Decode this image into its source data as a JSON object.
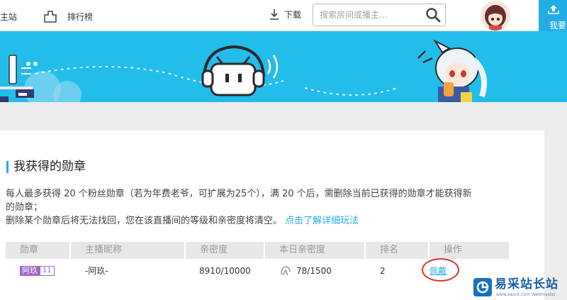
{
  "nav": {
    "main_label": "主站",
    "rank_label": "排行榜",
    "download_label": "下载",
    "search_placeholder": "搜索房间或播主...",
    "broadcast_label": "我要"
  },
  "panel": {
    "title": "我获得的勋章",
    "desc_line1": "每人最多获得 20 个粉丝勋章（若为年费老爷，可扩展为25个），满 20 个后，需删除当前已获得的勋章才能获得新",
    "desc_line2": "的勋章；",
    "desc_line3": "删除某个勋章后将无法找回，您在该直播间的等级和亲密度将清空。",
    "desc_link": "点击了解详细玩法"
  },
  "table": {
    "headers": [
      "勋章",
      "主播昵称",
      "亲密度",
      "本日亲密度",
      "排名",
      "操作"
    ],
    "row": {
      "badge_name": "阿玖",
      "badge_level": "11",
      "streamer": "-阿玖-",
      "intimacy": "8910/10000",
      "today_intimacy": "78/1500",
      "rank": "2",
      "action": "佩戴"
    }
  },
  "watermark": {
    "brand": "易采站长站",
    "sub": "www.easck.com Webmaster"
  },
  "colors": {
    "accent": "#23ade5",
    "banner": "#23bdec",
    "badge": "#a069c8",
    "highlight": "#d9352e"
  }
}
